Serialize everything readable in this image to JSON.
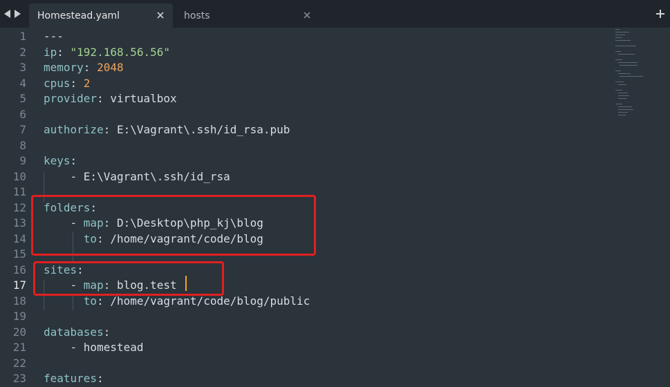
{
  "tabs": [
    {
      "label": "Homestead.yaml",
      "active": true
    },
    {
      "label": "hosts",
      "active": false
    }
  ],
  "editor": {
    "current_line": 17,
    "lines": [
      {
        "no": "1",
        "tokens": [
          {
            "t": "---",
            "c": "p"
          }
        ]
      },
      {
        "no": "2",
        "tokens": [
          {
            "t": "ip",
            "c": "k"
          },
          {
            "t": ": ",
            "c": "p"
          },
          {
            "t": "\"192.168.56.56\"",
            "c": "s"
          }
        ]
      },
      {
        "no": "3",
        "tokens": [
          {
            "t": "memory",
            "c": "k"
          },
          {
            "t": ": ",
            "c": "p"
          },
          {
            "t": "2048",
            "c": "n"
          }
        ]
      },
      {
        "no": "4",
        "tokens": [
          {
            "t": "cpus",
            "c": "k"
          },
          {
            "t": ": ",
            "c": "p"
          },
          {
            "t": "2",
            "c": "n"
          }
        ]
      },
      {
        "no": "5",
        "tokens": [
          {
            "t": "provider",
            "c": "k"
          },
          {
            "t": ": ",
            "c": "p"
          },
          {
            "t": "virtualbox",
            "c": "v"
          }
        ]
      },
      {
        "no": "6",
        "tokens": []
      },
      {
        "no": "7",
        "tokens": [
          {
            "t": "authorize",
            "c": "k"
          },
          {
            "t": ": ",
            "c": "p"
          },
          {
            "t": "E:\\Vagrant\\.ssh/id_rsa.pub",
            "c": "v"
          }
        ]
      },
      {
        "no": "8",
        "tokens": []
      },
      {
        "no": "9",
        "tokens": [
          {
            "t": "keys",
            "c": "k"
          },
          {
            "t": ":",
            "c": "p"
          }
        ]
      },
      {
        "no": "10",
        "tokens": [
          {
            "t": "    - ",
            "c": "p"
          },
          {
            "t": "E:\\Vagrant\\.ssh/id_rsa",
            "c": "v"
          }
        ]
      },
      {
        "no": "11",
        "tokens": []
      },
      {
        "no": "12",
        "tokens": [
          {
            "t": "folders",
            "c": "k"
          },
          {
            "t": ":",
            "c": "p"
          }
        ]
      },
      {
        "no": "13",
        "tokens": [
          {
            "t": "    - ",
            "c": "p"
          },
          {
            "t": "map",
            "c": "k"
          },
          {
            "t": ": ",
            "c": "p"
          },
          {
            "t": "D:\\Desktop\\php_kj\\blog",
            "c": "v"
          }
        ]
      },
      {
        "no": "14",
        "tokens": [
          {
            "t": "      ",
            "c": "p"
          },
          {
            "t": "to",
            "c": "k"
          },
          {
            "t": ": ",
            "c": "p"
          },
          {
            "t": "/home/vagrant/code/blog",
            "c": "v"
          }
        ]
      },
      {
        "no": "15",
        "tokens": []
      },
      {
        "no": "16",
        "tokens": [
          {
            "t": "sites",
            "c": "k"
          },
          {
            "t": ":",
            "c": "p"
          }
        ]
      },
      {
        "no": "17",
        "tokens": [
          {
            "t": "    - ",
            "c": "p"
          },
          {
            "t": "map",
            "c": "k"
          },
          {
            "t": ": ",
            "c": "p"
          },
          {
            "t": "blog.test",
            "c": "v"
          }
        ]
      },
      {
        "no": "18",
        "tokens": [
          {
            "t": "      ",
            "c": "p"
          },
          {
            "t": "to",
            "c": "k"
          },
          {
            "t": ": ",
            "c": "p"
          },
          {
            "t": "/home/vagrant/code/blog/public",
            "c": "v"
          }
        ]
      },
      {
        "no": "19",
        "tokens": []
      },
      {
        "no": "20",
        "tokens": [
          {
            "t": "databases",
            "c": "k"
          },
          {
            "t": ":",
            "c": "p"
          }
        ]
      },
      {
        "no": "21",
        "tokens": [
          {
            "t": "    - ",
            "c": "p"
          },
          {
            "t": "homestead",
            "c": "v"
          }
        ]
      },
      {
        "no": "22",
        "tokens": []
      },
      {
        "no": "23",
        "tokens": [
          {
            "t": "features",
            "c": "k"
          },
          {
            "t": ":",
            "c": "p"
          }
        ]
      }
    ]
  },
  "icons": {
    "nav_back": "chevron-left-icon",
    "nav_forward": "chevron-right-icon",
    "tab_close": "close-icon",
    "new_tab": "plus-icon"
  },
  "colors": {
    "background": "#2b333b",
    "tabbar": "#1f252b",
    "key": "#8fc3c6",
    "string": "#a5d393",
    "number": "#f0a45d",
    "annotation": "#e02020",
    "cursor": "#f5a623"
  }
}
